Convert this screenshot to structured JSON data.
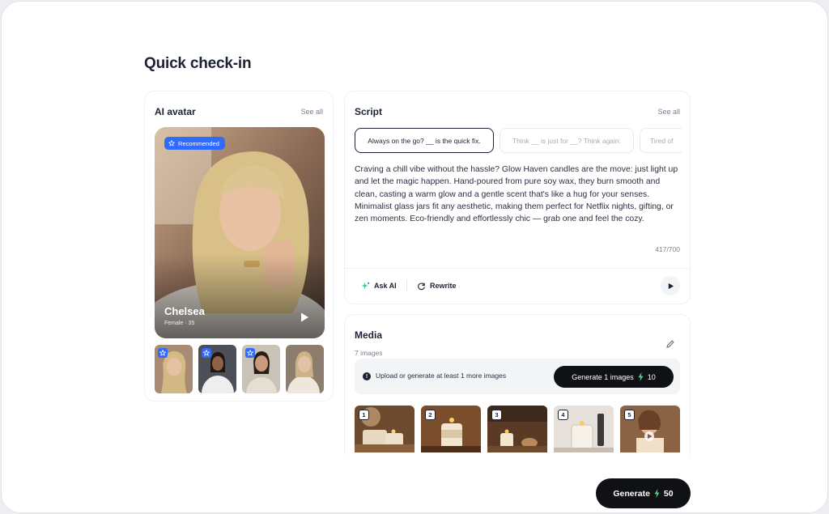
{
  "page_title": "Quick check-in",
  "avatar": {
    "title": "AI avatar",
    "see_all": "See all",
    "badge": "Recommended",
    "name": "Chelsea",
    "meta": "Female · 35",
    "thumbnails": [
      "avatar-1",
      "avatar-2",
      "avatar-3",
      "avatar-4"
    ]
  },
  "script": {
    "title": "Script",
    "see_all": "See all",
    "chips": [
      "Always on the go? __ is the quick fix.",
      "Think __ is just for __? Think again.",
      "Tired of"
    ],
    "text": "Craving a chill vibe without the hassle? Glow Haven candles are the move: just light up and let the magic happen. Hand-poured from pure soy wax, they burn smooth and clean, casting a warm glow and a gentle scent that's like a hug for your senses. Minimalist glass jars fit any aesthetic, making them perfect for Netflix nights, gifting, or zen moments. Eco-friendly and effortlessly chic — grab one and feel the cozy.",
    "char_count": "417/700",
    "ask_ai": "Ask AI",
    "rewrite": "Rewrite"
  },
  "media": {
    "title": "Media",
    "count": "7 images",
    "notice": "Upload or generate at least 1 more images",
    "generate_images_label": "Generate 1 images",
    "generate_images_cost": "10",
    "tiles": [
      "1",
      "2",
      "3",
      "4",
      "5"
    ]
  },
  "generate": {
    "label": "Generate",
    "cost": "50"
  },
  "colors": {
    "accent_blue": "#2f6bff",
    "button_dark": "#0f1115",
    "bolt_green": "#3ddc84"
  }
}
